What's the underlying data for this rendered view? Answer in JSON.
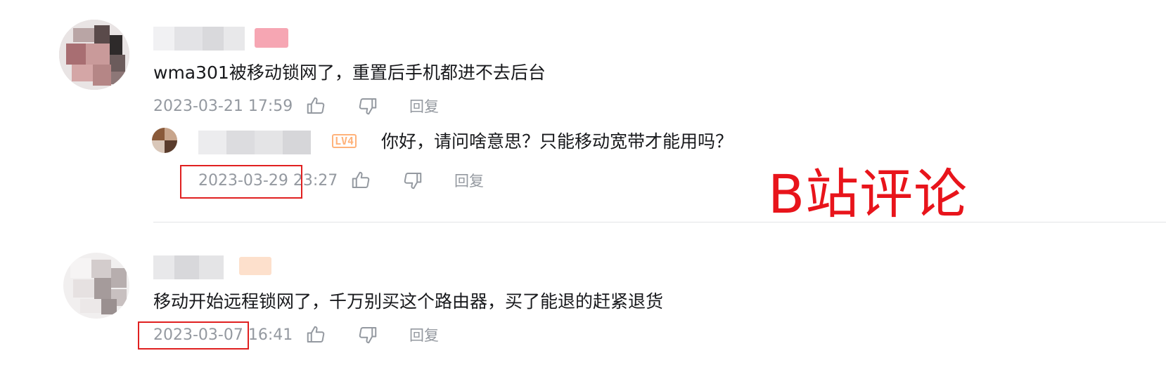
{
  "comments": [
    {
      "text": "wma301被移动锁网了，重置后手机都进不去后台",
      "time": "2023-03-21 17:59",
      "reply_label": "回复",
      "replies": [
        {
          "level": "LV4",
          "text": "你好，请问啥意思？只能移动宽带才能用吗？",
          "time": "2023-03-29 23:27",
          "reply_label": "回复"
        }
      ]
    },
    {
      "text": "移动开始远程锁网了，千万别买这个路由器，买了能退的赶紧退货",
      "time": "2023-03-07 16:41",
      "reply_label": "回复"
    }
  ],
  "annotation": {
    "watermark": "B站评论",
    "color": "#e8141b"
  },
  "icons": {
    "like": "thumbs-up-icon",
    "dislike": "thumbs-down-icon"
  },
  "colors": {
    "meta_text": "#9499a0",
    "body_text": "#18191c",
    "highlight_box": "#e02020"
  }
}
